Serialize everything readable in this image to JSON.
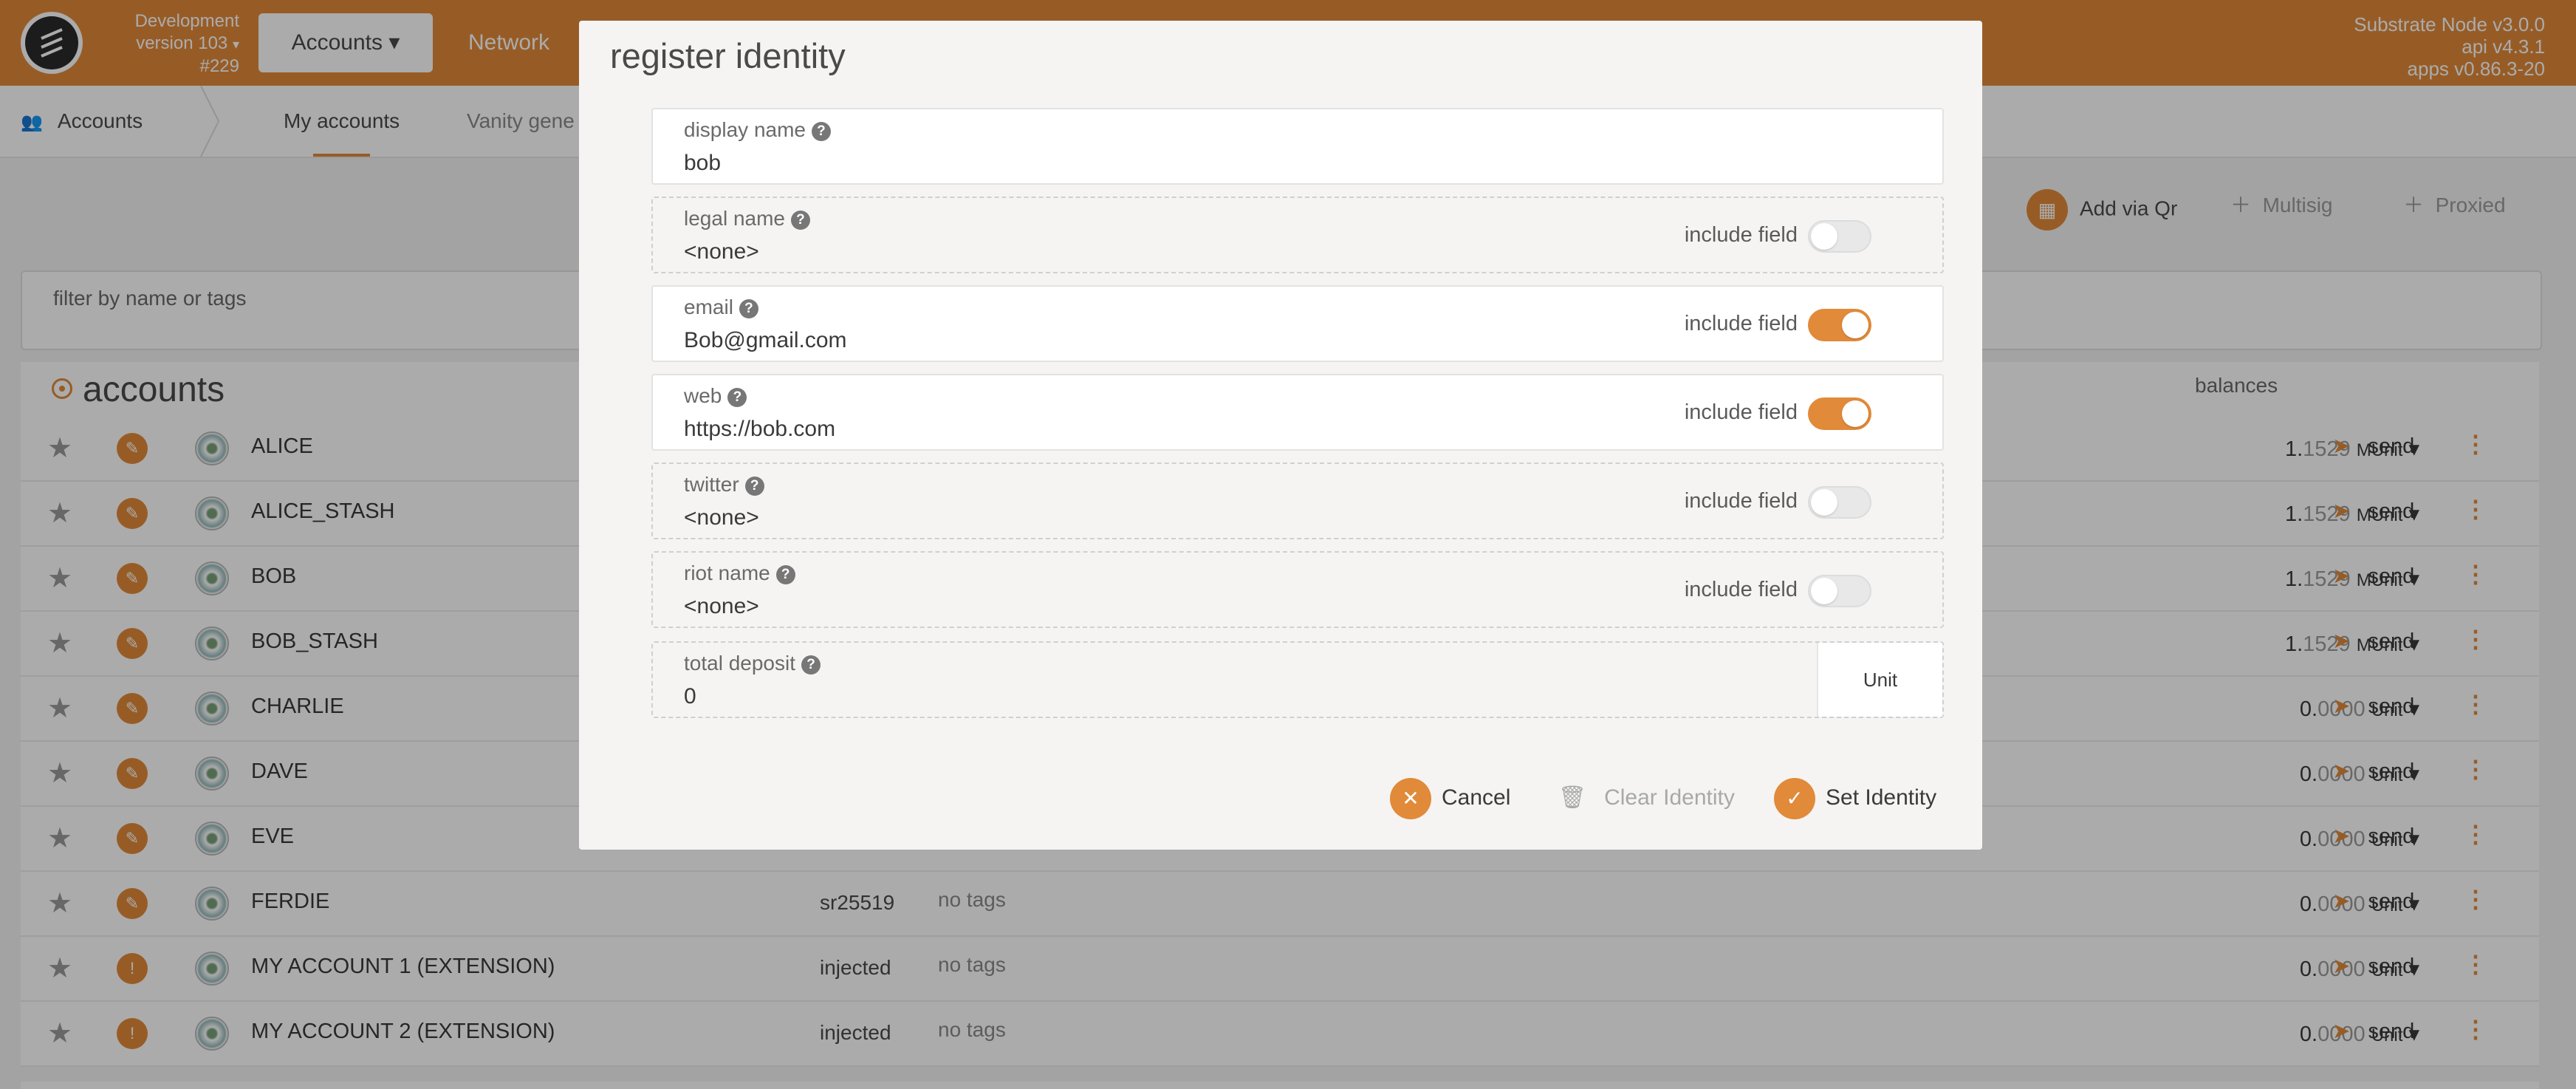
{
  "topbar": {
    "chain_name": "Development",
    "version": "version 103",
    "block": "#229",
    "tabs": [
      {
        "label": "Accounts"
      },
      {
        "label": "Network"
      }
    ],
    "node_info": [
      "Substrate Node v3.0.0",
      "api v4.3.1",
      "apps v0.86.3-20"
    ]
  },
  "subnav": {
    "crumb": "Accounts",
    "tabs": [
      "My accounts",
      "Vanity gene"
    ]
  },
  "actions": {
    "add_via_qr": "Add via Qr",
    "multisig": "Multisig",
    "proxied": "Proxied"
  },
  "filter": {
    "placeholder": "filter by name or tags"
  },
  "accounts": {
    "title": "accounts",
    "balances_header": "balances",
    "send_label": "send",
    "rows": [
      {
        "name": "ALICE",
        "type": "",
        "tags": "",
        "bal_int": "1.",
        "bal_dec": "1529",
        "unit": "MUnit",
        "warn": false
      },
      {
        "name": "ALICE_STASH",
        "type": "",
        "tags": "",
        "bal_int": "1.",
        "bal_dec": "1529",
        "unit": "MUnit",
        "warn": false
      },
      {
        "name": "BOB",
        "type": "",
        "tags": "",
        "bal_int": "1.",
        "bal_dec": "1529",
        "unit": "MUnit",
        "warn": false
      },
      {
        "name": "BOB_STASH",
        "type": "",
        "tags": "",
        "bal_int": "1.",
        "bal_dec": "1529",
        "unit": "MUnit",
        "warn": false
      },
      {
        "name": "CHARLIE",
        "type": "",
        "tags": "",
        "bal_int": "0.",
        "bal_dec": "0000",
        "unit": "Unit",
        "warn": false
      },
      {
        "name": "DAVE",
        "type": "",
        "tags": "",
        "bal_int": "0.",
        "bal_dec": "0000",
        "unit": "Unit",
        "warn": false
      },
      {
        "name": "EVE",
        "type": "",
        "tags": "",
        "bal_int": "0.",
        "bal_dec": "0000",
        "unit": "Unit",
        "warn": false
      },
      {
        "name": "FERDIE",
        "type": "sr25519",
        "tags": "no tags",
        "bal_int": "0.",
        "bal_dec": "0000",
        "unit": "Unit",
        "warn": false
      },
      {
        "name": "MY ACCOUNT 1 (EXTENSION)",
        "type": "injected",
        "tags": "no tags",
        "bal_int": "0.",
        "bal_dec": "0000",
        "unit": "Unit",
        "warn": true
      },
      {
        "name": "MY ACCOUNT 2 (EXTENSION)",
        "type": "injected",
        "tags": "no tags",
        "bal_int": "0.",
        "bal_dec": "0000",
        "unit": "Unit",
        "warn": true
      }
    ]
  },
  "modal": {
    "title": "register identity",
    "include_label": "include field",
    "fields": [
      {
        "label": "display name",
        "value": "bob",
        "toggle": null,
        "solid": true
      },
      {
        "label": "legal name",
        "value": "<none>",
        "toggle": false,
        "solid": false
      },
      {
        "label": "email",
        "value": "Bob@gmail.com",
        "toggle": true,
        "solid": true
      },
      {
        "label": "web",
        "value": "https://bob.com",
        "toggle": true,
        "solid": true
      },
      {
        "label": "twitter",
        "value": "<none>",
        "toggle": false,
        "solid": false
      },
      {
        "label": "riot name",
        "value": "<none>",
        "toggle": false,
        "solid": false
      }
    ],
    "deposit": {
      "label": "total deposit",
      "value": "0",
      "unit": "Unit"
    },
    "buttons": {
      "cancel": "Cancel",
      "clear": "Clear Identity",
      "set": "Set Identity"
    }
  },
  "colors": {
    "accent": "#e18a3a"
  }
}
